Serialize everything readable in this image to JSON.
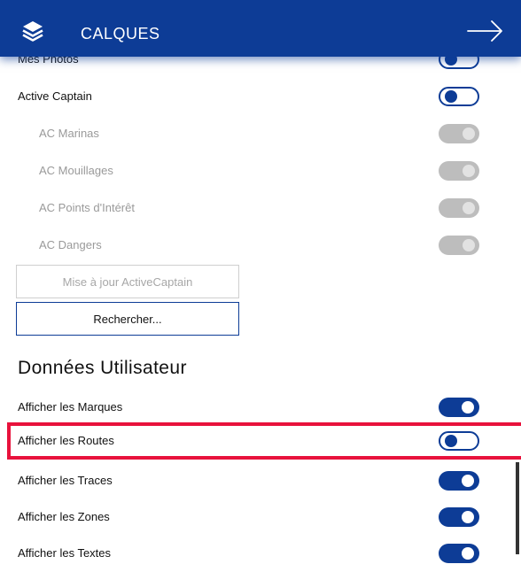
{
  "header": {
    "title": "CALQUES",
    "layers_icon": "layers-icon",
    "close_icon": "arrow-right-icon"
  },
  "rows_top": [
    {
      "label": "Mes Photos",
      "toggle": "off"
    },
    {
      "label": "Active Captain",
      "toggle": "off"
    },
    {
      "label": "AC Marinas",
      "toggle": "disabled"
    },
    {
      "label": "AC Mouillages",
      "toggle": "disabled"
    },
    {
      "label": "AC Points d'Intérêt",
      "toggle": "disabled"
    },
    {
      "label": "AC Dangers",
      "toggle": "disabled"
    }
  ],
  "buttons": {
    "update_label": "Mise à jour ActiveCaptain",
    "search_label": "Rechercher..."
  },
  "section": {
    "title": "Données Utilisateur"
  },
  "rows_user": [
    {
      "label": "Afficher les Marques",
      "toggle": "on"
    },
    {
      "label": "Afficher les Routes",
      "toggle": "off"
    },
    {
      "label": "Afficher les Traces",
      "toggle": "on"
    },
    {
      "label": "Afficher les Zones",
      "toggle": "on"
    },
    {
      "label": "Afficher les Textes",
      "toggle": "on"
    }
  ],
  "colors": {
    "brand": "#0d3c96",
    "highlight": "#e8123c",
    "disabled": "#bdbdbd"
  }
}
